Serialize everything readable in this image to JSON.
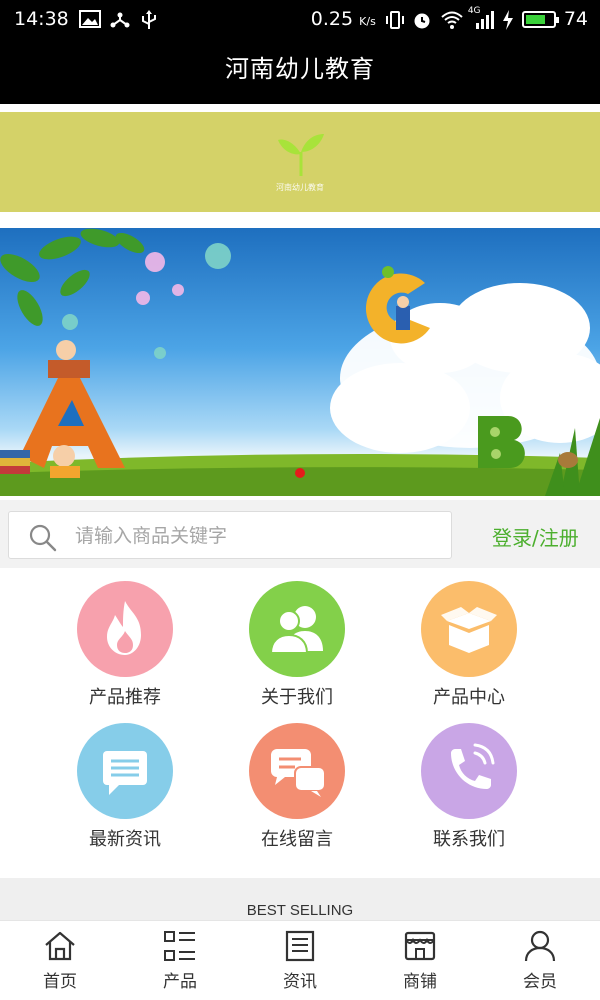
{
  "status_bar": {
    "time": "14:38",
    "speed": "0.25 ",
    "speed_unit": "K/s",
    "network": "4G",
    "battery_level": 74,
    "battery_text": "74",
    "battery_color": "#3ad13a"
  },
  "header": {
    "title": "河南幼儿教育"
  },
  "logo": {
    "caption": "河南幼儿教育",
    "color": "#a8e33a"
  },
  "banner": {
    "active_slide": 0,
    "dot_color": "#e41b1b"
  },
  "search": {
    "placeholder": "请输入商品关键字",
    "value": ""
  },
  "auth": {
    "login_register": "登录/注册"
  },
  "menu": {
    "items": [
      {
        "label": "产品推荐",
        "icon": "flame-icon",
        "color": "#f7a1ad"
      },
      {
        "label": "关于我们",
        "icon": "users-icon",
        "color": "#83d04a"
      },
      {
        "label": "产品中心",
        "icon": "box-icon",
        "color": "#fbbd6b"
      },
      {
        "label": "最新资讯",
        "icon": "message-icon",
        "color": "#86cde9"
      },
      {
        "label": "在线留言",
        "icon": "chat-icon",
        "color": "#f38e72"
      },
      {
        "label": "联系我们",
        "icon": "phone-icon",
        "color": "#c9a6e6"
      }
    ]
  },
  "section": {
    "best_selling": "BEST SELLING"
  },
  "bottom_nav": {
    "items": [
      {
        "label": "首页",
        "icon": "home-icon"
      },
      {
        "label": "产品",
        "icon": "grid-list-icon"
      },
      {
        "label": "资讯",
        "icon": "news-icon"
      },
      {
        "label": "商铺",
        "icon": "store-icon"
      },
      {
        "label": "会员",
        "icon": "user-icon"
      }
    ]
  }
}
